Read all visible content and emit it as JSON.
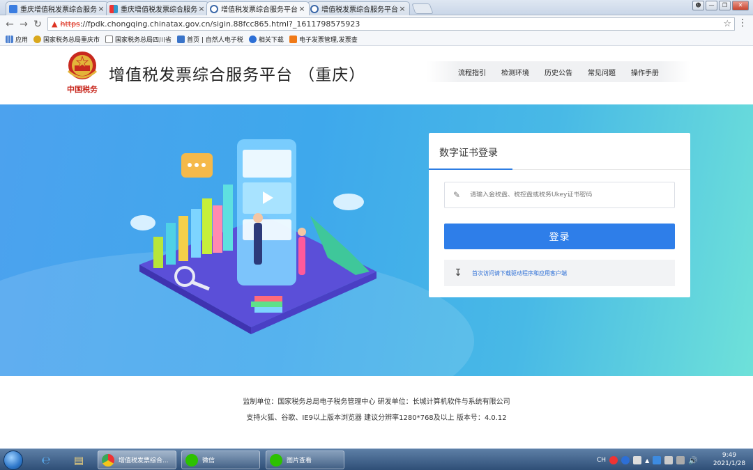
{
  "browser": {
    "tabs": [
      {
        "title": "重庆增值税发票综合服务",
        "icon": "paw-icon"
      },
      {
        "title": "重庆增值税发票综合服务",
        "icon": "app-grid-icon"
      },
      {
        "title": "增值税发票综合服务平台",
        "icon": "globe-icon"
      },
      {
        "title": "增值税发票综合服务平台",
        "icon": "globe-icon"
      }
    ],
    "url_scheme": "https",
    "url_rest": "://fpdk.chongqing.chinatax.gov.cn/sigin.88fcc865.html?_1611798575923",
    "bookmarks": [
      {
        "label": "应用",
        "icon": "apps-grid-icon"
      },
      {
        "label": "国家税务总局重庆市",
        "icon": "tax-emblem-icon"
      },
      {
        "label": "国家税务总局四川省",
        "icon": "page-icon"
      },
      {
        "label": "首页 | 自然人电子税",
        "icon": "tax-app-icon"
      },
      {
        "label": "相关下载",
        "icon": "search-badge-icon"
      },
      {
        "label": "电子发票管理,发票查",
        "icon": "invoice-icon"
      }
    ]
  },
  "header": {
    "title": "增值税发票综合服务平台 （重庆）",
    "emblem_caption": "中国税务",
    "nav": [
      "流程指引",
      "检测环境",
      "历史公告",
      "常见问题",
      "操作手册"
    ]
  },
  "login": {
    "tab_label": "数字证书登录",
    "password_placeholder": "请输入金税盘、税控盘或税务Ukey证书密码",
    "login_button": "登录",
    "download_text": "首次访问请下载驱动程序和应用客户端"
  },
  "footer": {
    "line1": "监制单位：国家税务总局电子税务管理中心    研发单位：长城计算机软件与系统有限公司",
    "line2": "支持火狐、谷歌、IE9以上版本浏览器    建议分辨率1280*768及以上    版本号：4.0.12"
  },
  "taskbar": {
    "items": [
      {
        "label": "增值税发票综合...",
        "icon": "chrome-icon"
      },
      {
        "label": "微信",
        "icon": "wechat-icon"
      },
      {
        "label": "图片查看",
        "icon": "wechat-icon"
      }
    ],
    "tray_lang": "CH",
    "time": "9:49",
    "date": "2021/1/28"
  },
  "colors": {
    "primary": "#2e7ee9",
    "banner_start": "#4ca2ee",
    "banner_end": "#6ee1d9"
  }
}
